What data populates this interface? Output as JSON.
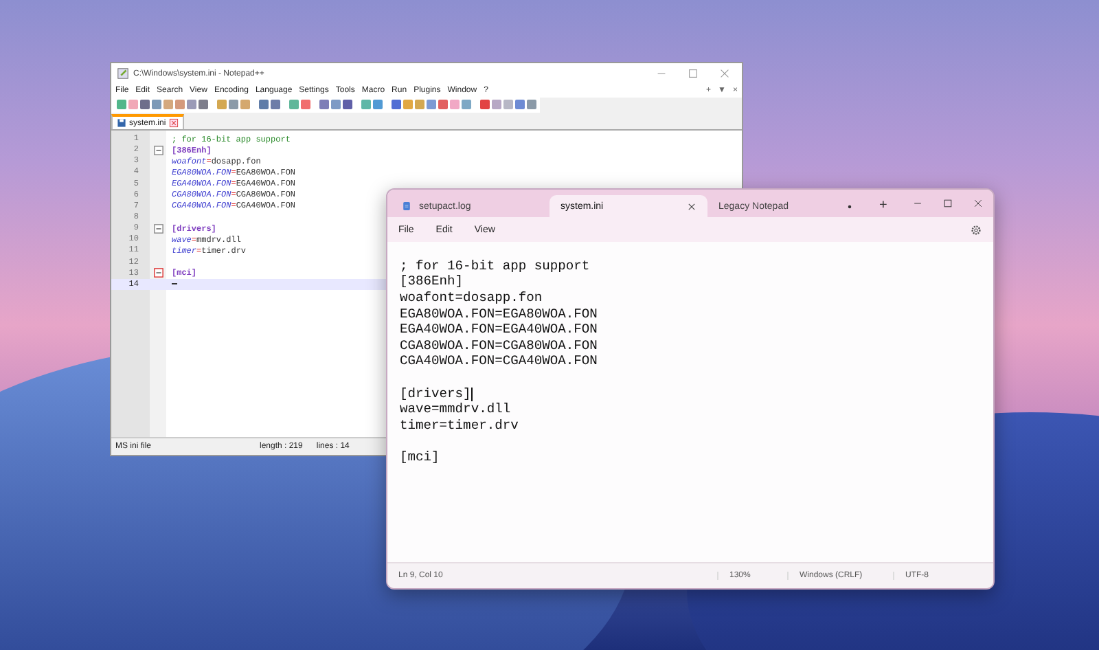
{
  "npp": {
    "title": "C:\\Windows\\system.ini - Notepad++",
    "menu": [
      "File",
      "Edit",
      "Search",
      "View",
      "Encoding",
      "Language",
      "Settings",
      "Tools",
      "Macro",
      "Run",
      "Plugins",
      "Window",
      "?"
    ],
    "menu_right": [
      "+",
      "▼",
      "×"
    ],
    "tabs": [
      {
        "label": "system.ini",
        "selected": true
      }
    ],
    "lines": [
      {
        "number": "1",
        "kind": "comment",
        "text": "; for 16-bit app support",
        "current": false
      },
      {
        "number": "2",
        "kind": "section",
        "text": "[386Enh]",
        "current": false
      },
      {
        "number": "3",
        "kind": "pair",
        "key": "woafont",
        "separator": "=",
        "value": "dosapp.fon",
        "current": false
      },
      {
        "number": "4",
        "kind": "pair",
        "key": "EGA80WOA.FON",
        "separator": "=",
        "value": "EGA80WOA.FON",
        "current": false
      },
      {
        "number": "5",
        "kind": "pair",
        "key": "EGA40WOA.FON",
        "separator": "=",
        "value": "EGA40WOA.FON",
        "current": false
      },
      {
        "number": "6",
        "kind": "pair",
        "key": "CGA80WOA.FON",
        "separator": "=",
        "value": "CGA80WOA.FON",
        "current": false
      },
      {
        "number": "7",
        "kind": "pair",
        "key": "CGA40WOA.FON",
        "separator": "=",
        "value": "CGA40WOA.FON",
        "current": false
      },
      {
        "number": "8",
        "kind": "blank",
        "current": false
      },
      {
        "number": "9",
        "kind": "section",
        "text": "[drivers]",
        "current": false
      },
      {
        "number": "10",
        "kind": "pair",
        "key": "wave",
        "separator": "=",
        "value": "mmdrv.dll",
        "current": false
      },
      {
        "number": "11",
        "kind": "pair",
        "key": "timer",
        "separator": "=",
        "value": "timer.drv",
        "current": false
      },
      {
        "number": "12",
        "kind": "blank",
        "current": false
      },
      {
        "number": "13",
        "kind": "section",
        "text": "[mci]",
        "current": false
      },
      {
        "number": "14",
        "kind": "blank",
        "current": true
      }
    ],
    "status": {
      "type": "MS ini file",
      "length": "length : 219",
      "lines": "lines : 14"
    }
  },
  "notepad": {
    "tabs": [
      {
        "label": "setupact.log",
        "selected": false,
        "kind": "document"
      },
      {
        "label": "system.ini",
        "selected": true,
        "kind": "plain"
      },
      {
        "label": "Legacy Notepad",
        "selected": false,
        "kind": "unsaved"
      }
    ],
    "new_tab": "+",
    "menu": [
      "File",
      "Edit",
      "View"
    ],
    "lines": [
      {
        "kind": "text",
        "text": "; for 16-bit app support",
        "cursor": false
      },
      {
        "kind": "text",
        "text": "[386Enh]",
        "cursor": false
      },
      {
        "kind": "text",
        "text": "woafont=dosapp.fon",
        "cursor": false
      },
      {
        "kind": "text",
        "text": "EGA80WOA.FON=EGA80WOA.FON",
        "cursor": false
      },
      {
        "kind": "text",
        "text": "EGA40WOA.FON=EGA40WOA.FON",
        "cursor": false
      },
      {
        "kind": "text",
        "text": "CGA80WOA.FON=CGA80WOA.FON",
        "cursor": false
      },
      {
        "kind": "text",
        "text": "CGA40WOA.FON=CGA40WOA.FON",
        "cursor": false
      },
      {
        "kind": "blank"
      },
      {
        "kind": "text",
        "text": "[drivers]",
        "cursor": true
      },
      {
        "kind": "text",
        "text": "wave=mmdrv.dll",
        "cursor": false
      },
      {
        "kind": "text",
        "text": "timer=timer.drv",
        "cursor": false
      },
      {
        "kind": "blank"
      },
      {
        "kind": "text",
        "text": "[mci]",
        "cursor": false
      }
    ],
    "status": {
      "position": "Ln 9, Col 10",
      "zoom": "130%",
      "line_ending": "Windows (CRLF)",
      "encoding": "UTF-8"
    }
  }
}
